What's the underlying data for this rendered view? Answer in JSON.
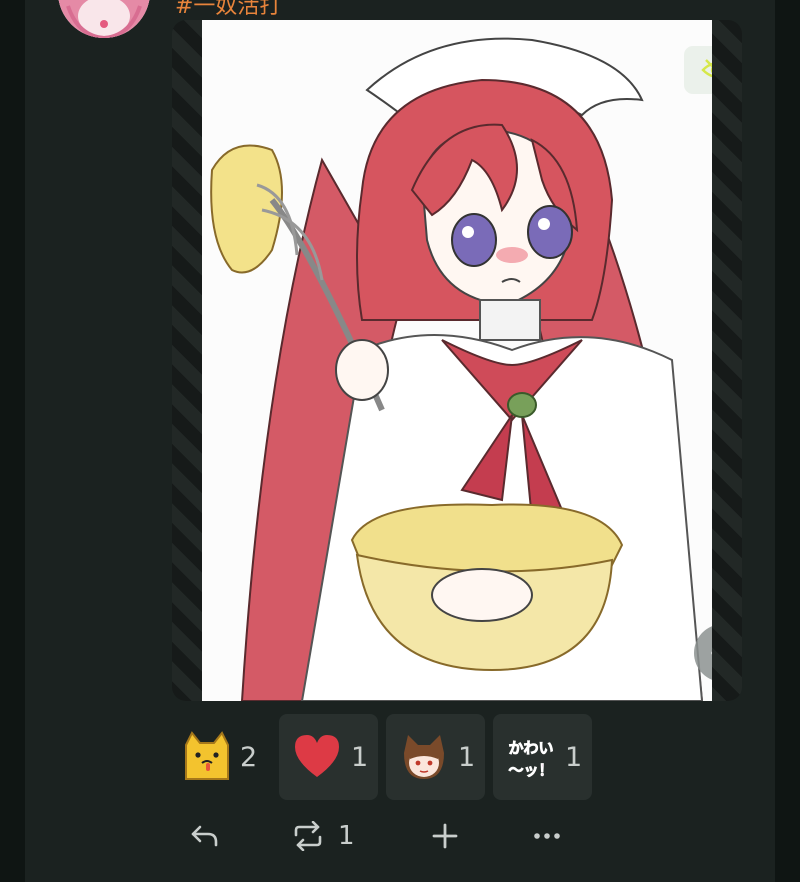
{
  "note": {
    "hashtag": "#一奴活打",
    "media": {
      "hide_icon": "eye-slash-icon",
      "menu_icon": "ellipsis-icon",
      "description": ""
    },
    "reactions": [
      {
        "emoji": "yellow-cat-emoji",
        "count": "2",
        "reacted": false
      },
      {
        "emoji": "red-heart-emoji",
        "count": "1",
        "reacted": true
      },
      {
        "emoji": "catgirl-emoji",
        "count": "1",
        "reacted": true
      },
      {
        "emoji": "kawaii-text-emoji",
        "text": "かわい〜ッ！",
        "count": "1",
        "reacted": true
      }
    ],
    "footer": {
      "reply_icon": "reply-icon",
      "renote_icon": "renote-icon",
      "renote_count": "1",
      "react_icon": "plus-icon",
      "more_icon": "more-icon"
    }
  },
  "colors": {
    "background": "#0f1513",
    "card": "#1b2220",
    "accent": "#e8843b",
    "pill": "#29302e",
    "text": "#c9cecc",
    "eye_icon": "#d6e84a"
  }
}
